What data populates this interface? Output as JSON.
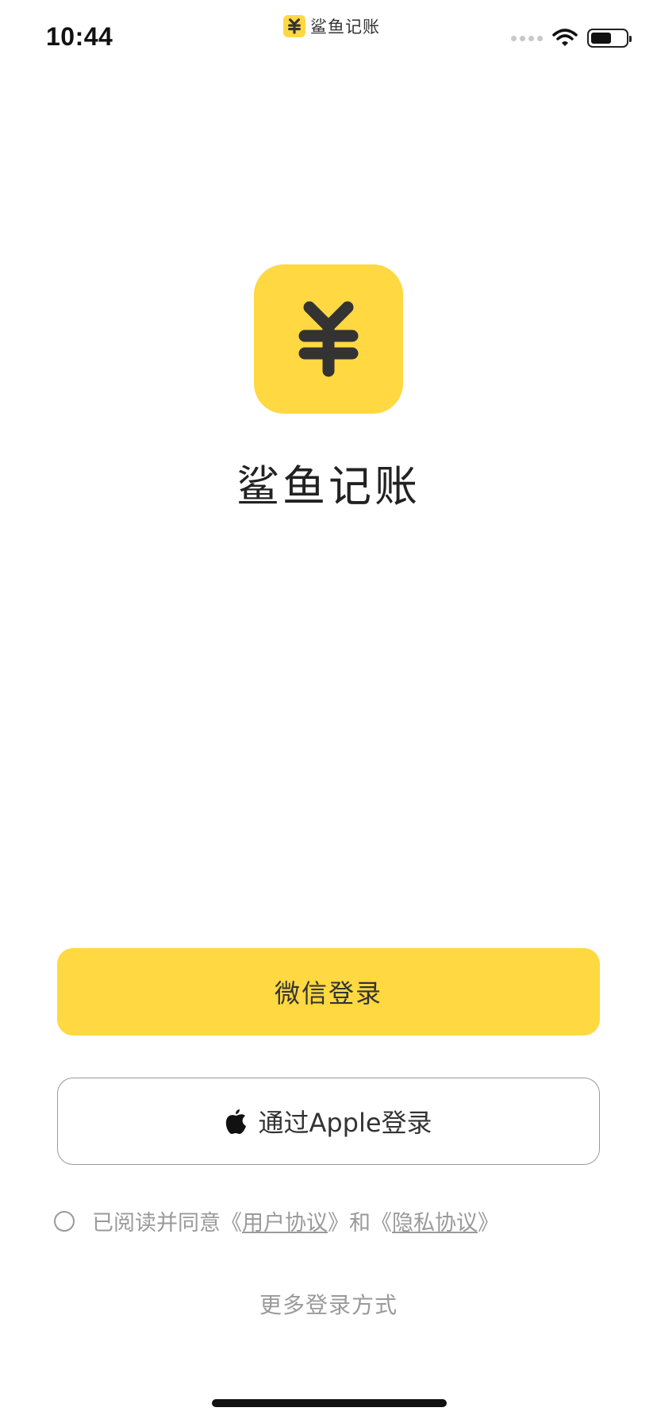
{
  "status_bar": {
    "time": "10:44",
    "app_name": "鲨鱼记账"
  },
  "app": {
    "name": "鲨鱼记账",
    "brand_color": "#FFD842"
  },
  "buttons": {
    "wechat_login": "微信登录",
    "apple_login": "通过Apple登录"
  },
  "agreement": {
    "prefix": "已阅读并同意《",
    "user_agreement": "用户协议",
    "middle": "》和《",
    "privacy_agreement": "隐私协议",
    "suffix": "》"
  },
  "more_login": "更多登录方式",
  "icons": {
    "logo": "yuan-icon",
    "apple": "apple-icon",
    "wifi": "wifi-icon",
    "battery": "battery-icon"
  }
}
